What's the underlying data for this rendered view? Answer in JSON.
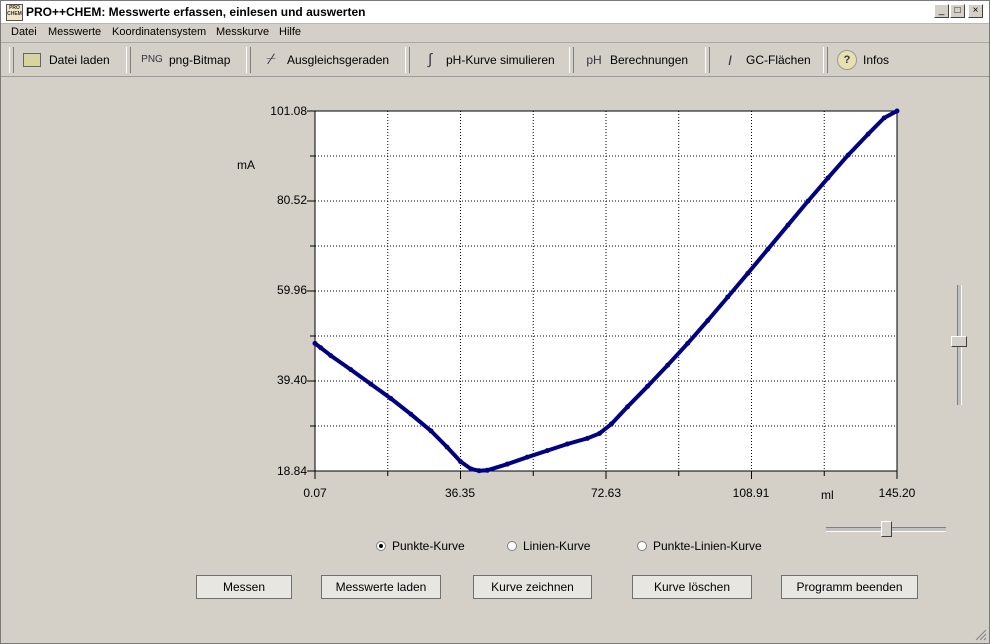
{
  "window": {
    "title": "PRO++CHEM: Messwerte erfassen, einlesen und auswerten",
    "icon_text": "PRO CHEM",
    "buttons": {
      "minimize": "_",
      "maximize": "□",
      "close": "×"
    }
  },
  "menu": [
    "Datei",
    "Messwerte",
    "Koordinatensystem",
    "Messkurve",
    "Hilfe"
  ],
  "toolbar": [
    {
      "label": "Datei laden",
      "icon": "folder-icon",
      "glyph": "▭"
    },
    {
      "label": "png-Bitmap",
      "icon": "png-icon",
      "glyph": "PNG"
    },
    {
      "label": "Ausgleichsgeraden",
      "icon": "regression-lines-icon",
      "glyph": "⌿"
    },
    {
      "label": "pH-Kurve simulieren",
      "icon": "ph-curve-icon",
      "glyph": "∫"
    },
    {
      "label": "Berechnungen",
      "icon": "ph-calc-icon",
      "glyph": "pH"
    },
    {
      "label": "GC-Flächen",
      "icon": "integral-icon",
      "glyph": "I"
    },
    {
      "label": "Infos",
      "icon": "help-icon",
      "glyph": "?"
    }
  ],
  "chart_data": {
    "type": "line",
    "xlabel": "ml",
    "ylabel": "mA",
    "xlim": [
      0.07,
      145.2
    ],
    "ylim": [
      18.84,
      101.08
    ],
    "x_ticks": [
      "0.07",
      "36.35",
      "72.63",
      "108.91",
      "145.20"
    ],
    "y_ticks": [
      "18.84",
      "39.40",
      "59.96",
      "80.52",
      "101.08"
    ],
    "grid": true,
    "series": [
      {
        "color": "#000080",
        "points": [
          [
            0.07,
            48.0
          ],
          [
            1.5,
            47.0
          ],
          [
            4.0,
            45.2
          ],
          [
            9.0,
            42.0
          ],
          [
            14.0,
            38.7
          ],
          [
            19.0,
            35.4
          ],
          [
            24.0,
            31.8
          ],
          [
            29.0,
            28.0
          ],
          [
            33.0,
            24.3
          ],
          [
            36.35,
            21.0
          ],
          [
            39.0,
            19.3
          ],
          [
            41.0,
            18.9
          ],
          [
            43.0,
            19.0
          ],
          [
            48.0,
            20.4
          ],
          [
            53.0,
            22.0
          ],
          [
            58.0,
            23.5
          ],
          [
            63.0,
            25.0
          ],
          [
            68.0,
            26.3
          ],
          [
            71.0,
            27.4
          ],
          [
            74.0,
            29.6
          ],
          [
            78.0,
            33.5
          ],
          [
            83.0,
            38.2
          ],
          [
            88.0,
            43.0
          ],
          [
            93.0,
            48.0
          ],
          [
            98.0,
            53.2
          ],
          [
            103.0,
            58.6
          ],
          [
            108.0,
            64.0
          ],
          [
            113.0,
            69.5
          ],
          [
            118.0,
            75.0
          ],
          [
            123.0,
            80.5
          ],
          [
            128.0,
            85.8
          ],
          [
            133.0,
            91.0
          ],
          [
            138.0,
            95.8
          ],
          [
            142.0,
            99.5
          ],
          [
            145.2,
            101.08
          ]
        ]
      }
    ]
  },
  "options": {
    "curve_mode": [
      {
        "label": "Punkte-Kurve",
        "checked": true
      },
      {
        "label": "Linien-Kurve",
        "checked": false
      },
      {
        "label": "Punkte-Linien-Kurve",
        "checked": false
      }
    ]
  },
  "buttons": [
    "Messen",
    "Messwerte laden",
    "Kurve zeichnen",
    "Kurve löschen",
    "Programm beenden"
  ],
  "sliders": {
    "vertical_level": 0.47,
    "horizontal_level": 0.5
  }
}
